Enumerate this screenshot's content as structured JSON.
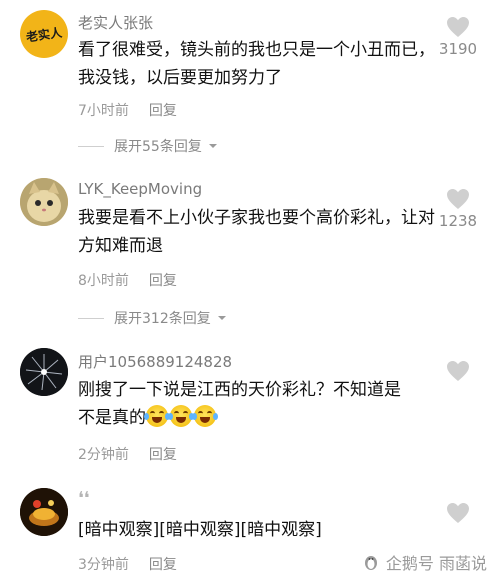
{
  "comments": [
    {
      "username": "老实人张张",
      "avatar_text": "老实人",
      "text": "看了很难受，镜头前的我也只是一个小丑而已，我没钱，以后要更加努力了",
      "time": "7小时前",
      "reply": "回复",
      "likes": "3190",
      "expand": "展开55条回复"
    },
    {
      "username": "LYK_KeepMoving",
      "text": "我要是看不上小伙子家我也要个高价彩礼，让对方知难而退",
      "time": "8小时前",
      "reply": "回复",
      "likes": "1238",
      "expand": "展开312条回复"
    },
    {
      "username": "用户1056889124828",
      "text_line1": "刚搜了一下说是江西的天价彩礼？不知道是",
      "text_line2": "不是真的",
      "time": "2分钟前",
      "reply": "回复",
      "likes": ""
    },
    {
      "username": "",
      "text": "[暗中观察][暗中观察][暗中观察]",
      "time": "3分钟前",
      "reply": "回复",
      "likes": ""
    }
  ],
  "watermark": "企鹅号 雨菡说",
  "colors": {
    "username": "#7a7a7a",
    "meta": "#9a9a9a",
    "like_icon": "#cfcfcf"
  }
}
